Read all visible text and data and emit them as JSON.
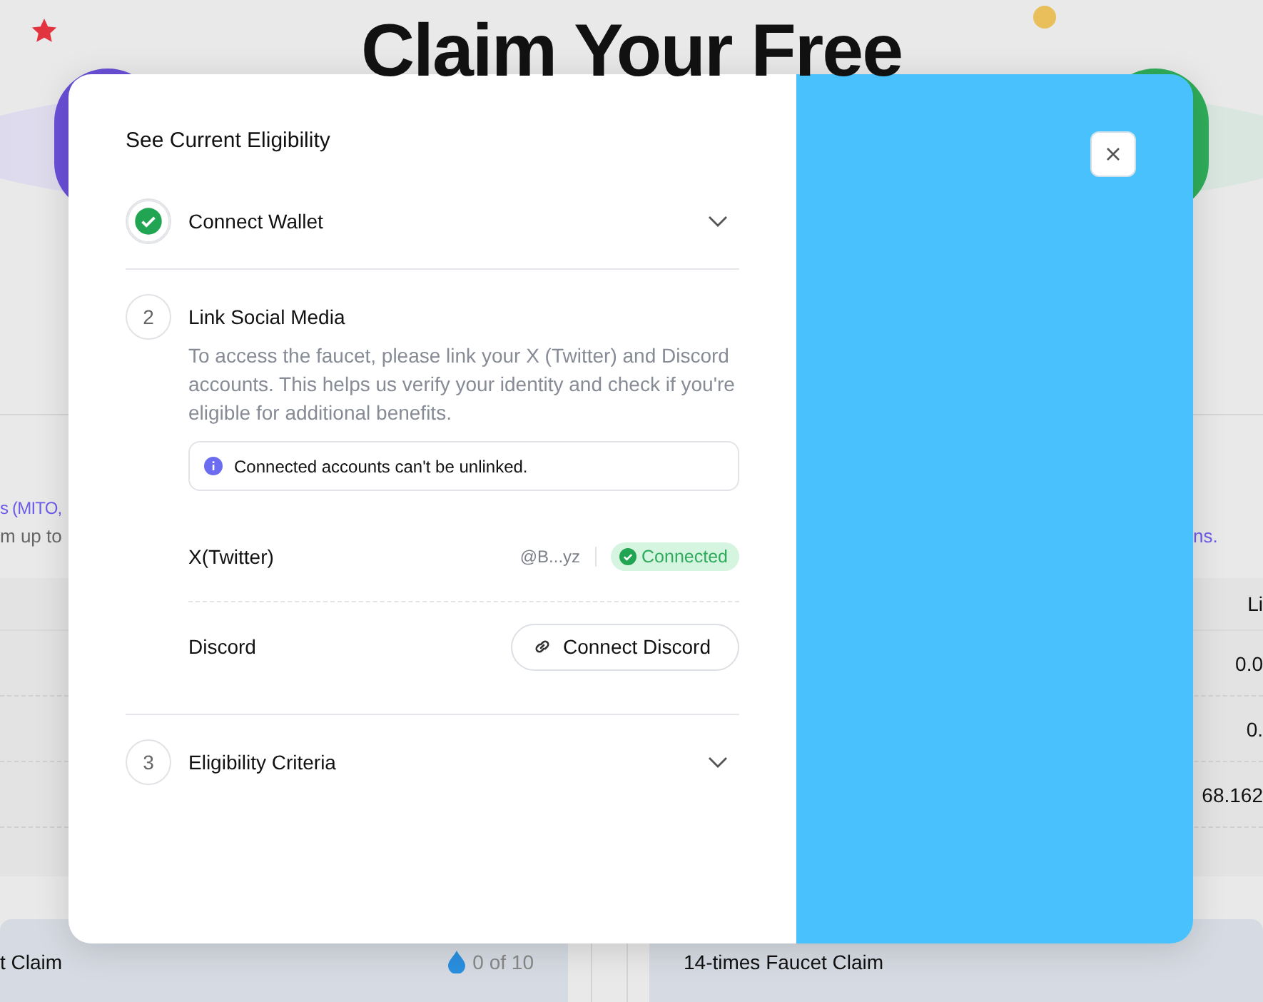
{
  "background": {
    "title": "Claim Your Free",
    "left_panel": {
      "link_text": "s (MITO,",
      "text": "m up to",
      "card_title": "t Claim",
      "claim_count": "0 of 10"
    },
    "right_panel": {
      "link_text": "ns.",
      "column_header": "Li",
      "values": [
        "0.0",
        "0.",
        "68.162"
      ],
      "card_title": "14-times Faucet Claim"
    }
  },
  "modal": {
    "title": "See Current Eligibility",
    "steps": [
      {
        "label": "Connect Wallet",
        "completed": true,
        "expanded": false
      },
      {
        "number": "2",
        "label": "Link Social Media",
        "completed": false,
        "expanded": true,
        "description": "To access the faucet, please link your X (Twitter) and Discord accounts. This helps us verify your identity and check if you're eligible for additional benefits.",
        "notice": "Connected accounts can't be unlinked.",
        "accounts": [
          {
            "name": "X(Twitter)",
            "connected": true,
            "handle": "@B...yz",
            "status": "Connected"
          },
          {
            "name": "Discord",
            "connected": false,
            "action": "Connect Discord"
          }
        ]
      },
      {
        "number": "3",
        "label": "Eligibility Criteria",
        "completed": false,
        "expanded": false
      }
    ]
  }
}
